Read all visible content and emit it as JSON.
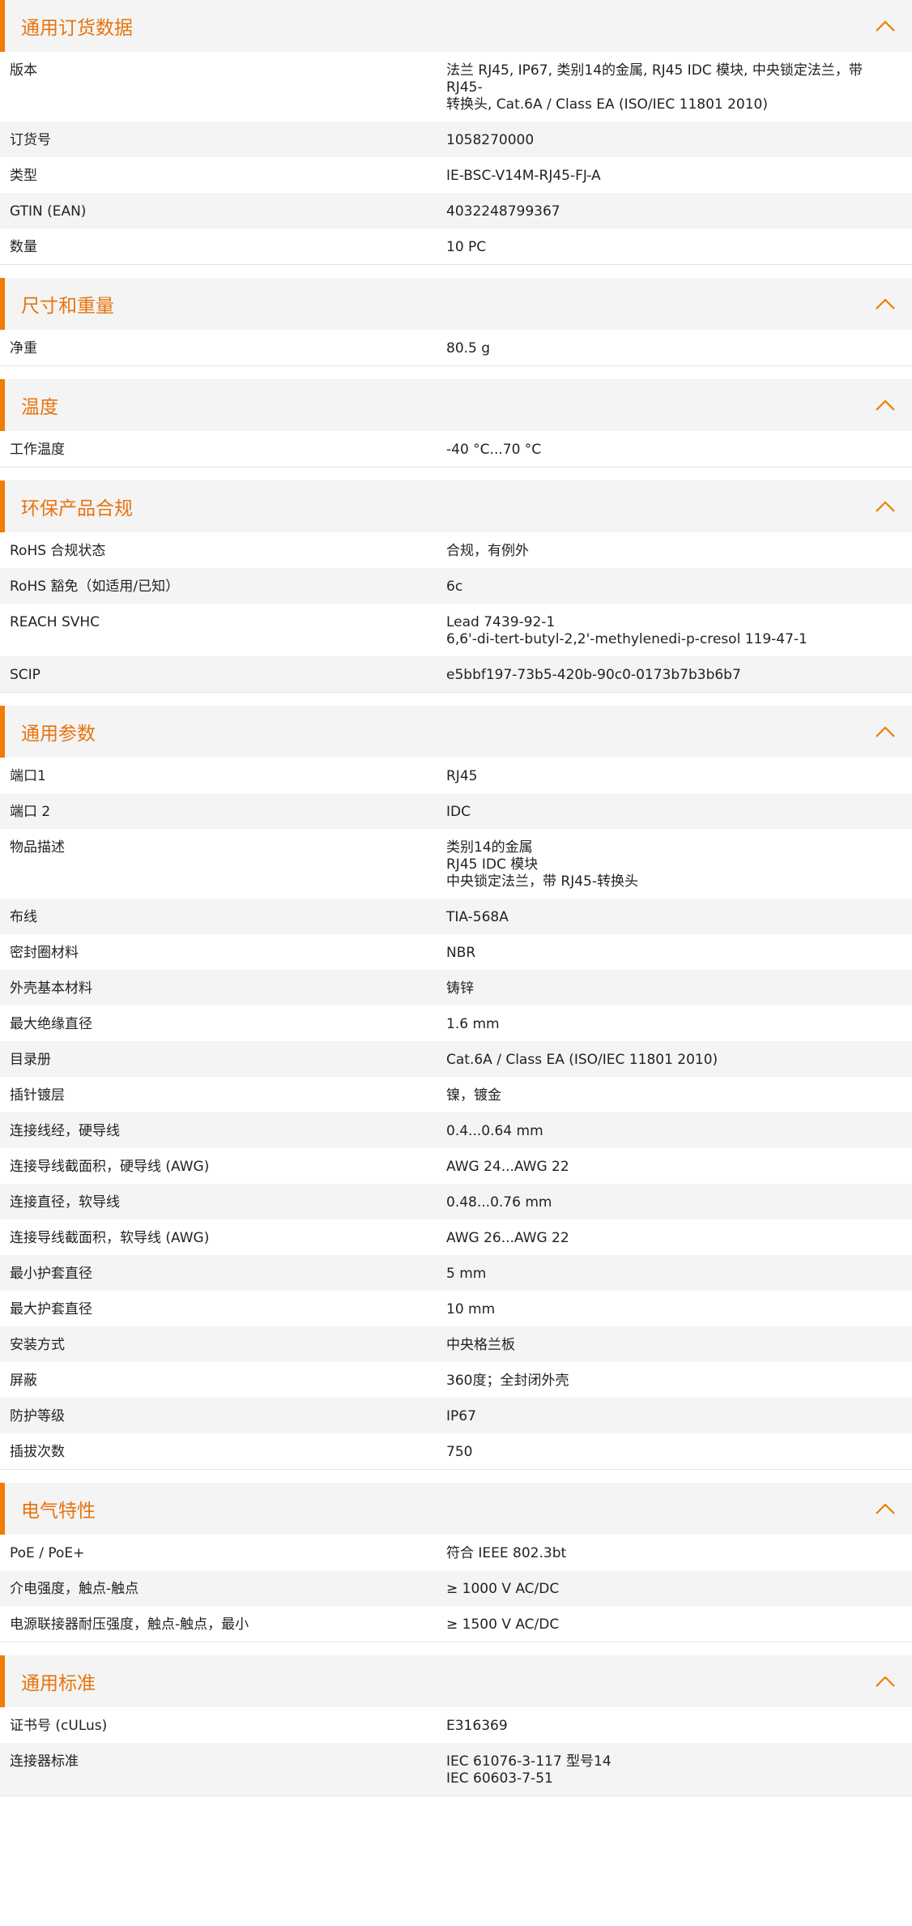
{
  "accent_color": "#f07c00",
  "collapse_icon": "chevron-up-icon",
  "sections": [
    {
      "title": "通用订货数据",
      "rows": [
        {
          "k": "版本",
          "v": [
            "法兰 RJ45, IP67, 类别14的金属, RJ45 IDC 模块, 中央锁定法兰，带 RJ45-",
            "转换头, Cat.6A / Class EA (ISO/IEC 11801 2010)"
          ]
        },
        {
          "k": "订货号",
          "v": [
            "1058270000"
          ]
        },
        {
          "k": "类型",
          "v": [
            "IE-BSC-V14M-RJ45-FJ-A"
          ]
        },
        {
          "k": "GTIN (EAN)",
          "v": [
            "4032248799367"
          ]
        },
        {
          "k": "数量",
          "v": [
            "10  PC"
          ]
        }
      ]
    },
    {
      "title": "尺寸和重量",
      "rows": [
        {
          "k": "净重",
          "v": [
            "80.5  g"
          ]
        }
      ]
    },
    {
      "title": "温度",
      "rows": [
        {
          "k": "工作温度",
          "v": [
            "-40 °C...70 °C"
          ]
        }
      ]
    },
    {
      "title": "环保产品合规",
      "rows": [
        {
          "k": "RoHS 合规状态",
          "v": [
            "合规，有例外"
          ]
        },
        {
          "k": "RoHS 豁免（如适用/已知）",
          "v": [
            "6c"
          ]
        },
        {
          "k": "REACH SVHC",
          "v": [
            "Lead 7439-92-1",
            "6,6'-di-tert-butyl-2,2'-methylenedi-p-cresol 119-47-1"
          ]
        },
        {
          "k": "SCIP",
          "v": [
            "e5bbf197-73b5-420b-90c0-0173b7b3b6b7"
          ]
        }
      ]
    },
    {
      "title": "通用参数",
      "rows": [
        {
          "k": "端口1",
          "v": [
            "RJ45"
          ]
        },
        {
          "k": "端口 2",
          "v": [
            "IDC"
          ]
        },
        {
          "k": "物品描述",
          "v": [
            "类别14的金属",
            "RJ45 IDC 模块",
            "中央锁定法兰，带 RJ45-转换头"
          ]
        },
        {
          "k": "布线",
          "v": [
            "TIA-568A"
          ]
        },
        {
          "k": "密封圈材料",
          "v": [
            "NBR"
          ]
        },
        {
          "k": "外壳基本材料",
          "v": [
            "铸锌"
          ]
        },
        {
          "k": "最大绝缘直径",
          "v": [
            "1.6  mm"
          ]
        },
        {
          "k": "目录册",
          "v": [
            "Cat.6A / Class EA (ISO/IEC 11801 2010)"
          ]
        },
        {
          "k": "插针镀层",
          "v": [
            "镍，镀金"
          ]
        },
        {
          "k": "连接线经，硬导线",
          "v": [
            "0.4...0.64 mm"
          ]
        },
        {
          "k": "连接导线截面积，硬导线 (AWG)",
          "v": [
            "AWG 24...AWG 22"
          ]
        },
        {
          "k": "连接直径，软导线",
          "v": [
            "0.48...0.76 mm"
          ]
        },
        {
          "k": "连接导线截面积，软导线 (AWG)",
          "v": [
            "AWG 26...AWG 22"
          ]
        },
        {
          "k": "最小护套直径",
          "v": [
            "5  mm"
          ]
        },
        {
          "k": "最大护套直径",
          "v": [
            "10  mm"
          ]
        },
        {
          "k": "安装方式",
          "v": [
            "中央格兰板"
          ]
        },
        {
          "k": "屏蔽",
          "v": [
            "360度；全封闭外壳"
          ]
        },
        {
          "k": "防护等级",
          "v": [
            "IP67"
          ]
        },
        {
          "k": "插拔次数",
          "v": [
            "750"
          ]
        }
      ]
    },
    {
      "title": "电气特性",
      "rows": [
        {
          "k": "PoE / PoE+",
          "v": [
            "符合 IEEE 802.3bt"
          ]
        },
        {
          "k": "介电强度，触点-触点",
          "v": [
            "≥ 1000 V AC/DC"
          ]
        },
        {
          "k": "电源联接器耐压强度，触点-触点，最小",
          "v": [
            "≥ 1500 V AC/DC"
          ]
        }
      ]
    },
    {
      "title": "通用标准",
      "rows": [
        {
          "k": "证书号 (cULus)",
          "v": [
            "E316369"
          ]
        },
        {
          "k": "连接器标准",
          "v": [
            "IEC 61076-3-117 型号14",
            "IEC 60603-7-51"
          ]
        }
      ]
    }
  ]
}
